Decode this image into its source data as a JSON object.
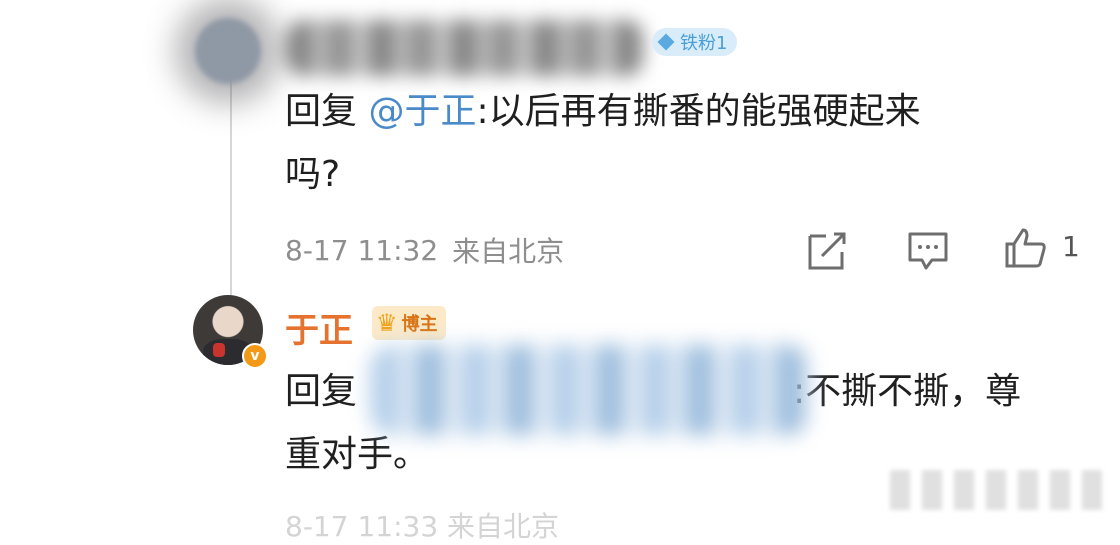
{
  "comment1": {
    "fan_badge": "铁粉1",
    "reply_prefix": "回复",
    "mention": "@于正",
    "reply_line1_rest": ":以后再有撕番的能强硬起来",
    "reply_line2": "吗?",
    "date": "8-17 11:32",
    "location": "来自北京",
    "like_count": "1",
    "icons": [
      "share-icon",
      "comment-icon",
      "like-icon"
    ]
  },
  "comment2": {
    "author": "于正",
    "blogger_badge": "博主",
    "reply_prefix": "回复",
    "reply_line1_rest": ":不撕不撕，尊",
    "reply_line2": "重对手。",
    "faded_meta": "8-17 11:33 来自北京"
  },
  "colors": {
    "mention": "#4a8ac9",
    "author": "#e5732f",
    "fan_badge": "#4a9fd8",
    "meta": "#8e8e8e"
  }
}
